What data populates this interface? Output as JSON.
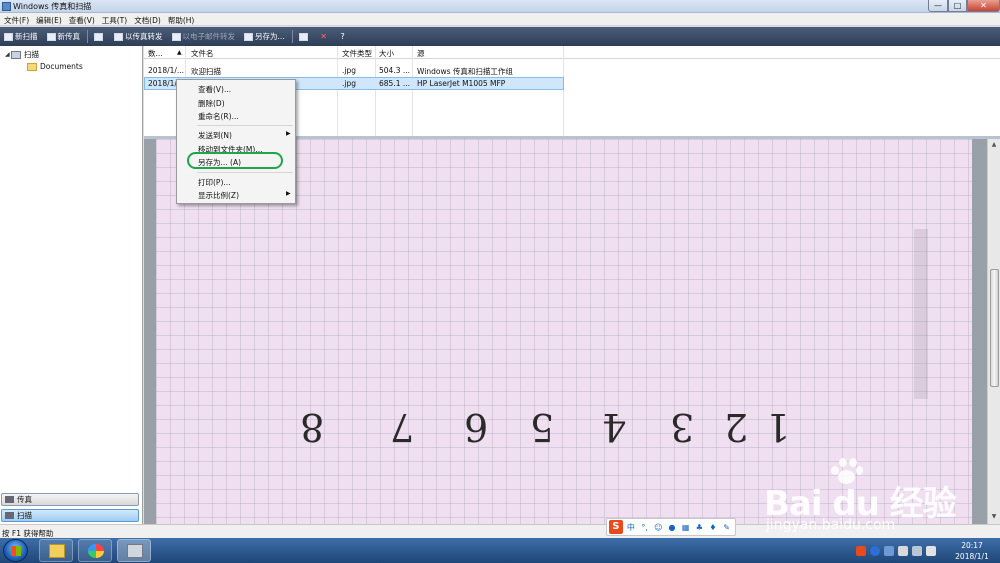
{
  "window": {
    "title": "Windows 传真和扫描",
    "controls": {
      "minimize": "—",
      "maximize": "□",
      "close": "✕"
    }
  },
  "menu": [
    "文件(F)",
    "编辑(E)",
    "查看(V)",
    "工具(T)",
    "文档(D)",
    "帮助(H)"
  ],
  "toolbar": {
    "new_scan": "新扫描",
    "new_fax": "新传真",
    "forward_fax": "以传真转发",
    "forward_email": "以电子邮件转发",
    "save_as": "另存为..."
  },
  "tree": {
    "root": "扫描",
    "child": "Documents"
  },
  "nav": {
    "fax": "传真",
    "scan": "扫描"
  },
  "list": {
    "columns": [
      "数...",
      "文件名",
      "文件类型",
      "大小",
      "源"
    ],
    "rows": [
      {
        "date": "2018/1/...",
        "name": "欢迎扫描",
        "type": ".jpg",
        "size": "504.3 ...",
        "source": "Windows 传真和扫描工作组"
      },
      {
        "date": "2018/1/...",
        "name": "",
        "type": ".jpg",
        "size": "685.1 ...",
        "source": "HP LaserJet M1005 MFP"
      }
    ]
  },
  "context_menu": {
    "view": "查看(V)...",
    "delete": "删除(D)",
    "rename": "重命名(R)...",
    "send_to": "发送到(N)",
    "move_to": "移动到文件夹(M)...",
    "save_as": "另存为... (A)",
    "print": "打印(P)...",
    "zoom": "显示比例(Z)"
  },
  "preview": {
    "digits": [
      "8",
      "7",
      "6",
      "5",
      "4",
      "3",
      "2",
      "1"
    ]
  },
  "status": {
    "text": "按 F1 获得帮助"
  },
  "ime": {
    "logo": "S",
    "lang": "中"
  },
  "watermark": {
    "brand": "Bai du 经验",
    "url": "jingyan.baidu.com"
  },
  "clock": {
    "time": "20:17",
    "date": "2018/1/1"
  },
  "colors": {
    "selection": "#cfe6fb",
    "highlight_ring": "#1ea64a",
    "toolbar": "#34435c",
    "paper": "#efdff0"
  }
}
